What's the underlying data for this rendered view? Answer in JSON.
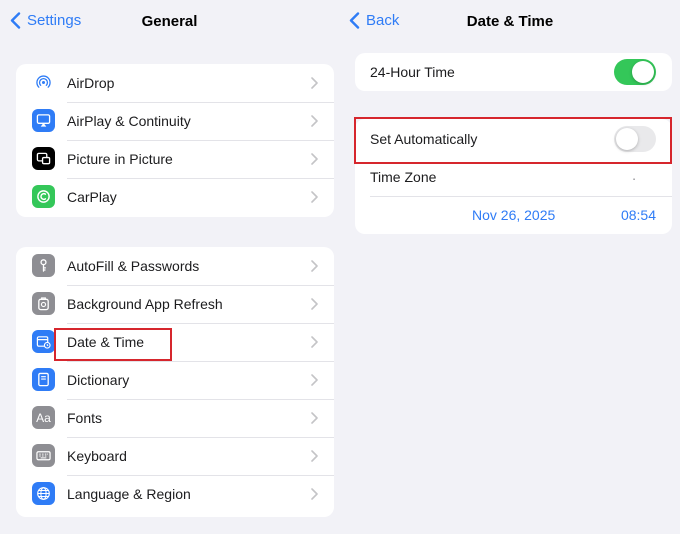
{
  "left": {
    "back_label": "Settings",
    "title": "General",
    "group1": [
      {
        "label": "AirDrop",
        "icon": "airdrop-icon"
      },
      {
        "label": "AirPlay & Continuity",
        "icon": "airplay-icon"
      },
      {
        "label": "Picture in Picture",
        "icon": "picture-in-picture-icon"
      },
      {
        "label": "CarPlay",
        "icon": "carplay-icon"
      }
    ],
    "group2": [
      {
        "label": "AutoFill & Passwords",
        "icon": "autofill-icon"
      },
      {
        "label": "Background App Refresh",
        "icon": "refresh-icon"
      },
      {
        "label": "Date & Time",
        "icon": "calendar-clock-icon"
      },
      {
        "label": "Dictionary",
        "icon": "dictionary-icon"
      },
      {
        "label": "Fonts",
        "icon": "fonts-icon",
        "glyph": "Aa"
      },
      {
        "label": "Keyboard",
        "icon": "keyboard-icon"
      },
      {
        "label": "Language & Region",
        "icon": "globe-icon"
      }
    ]
  },
  "right": {
    "back_label": "Back",
    "title": "Date & Time",
    "hour24_label": "24-Hour Time",
    "hour24_on": true,
    "set_auto_label": "Set Automatically",
    "set_auto_on": false,
    "timezone_label": "Time Zone",
    "timezone_value": ".",
    "date": "Nov 26, 2025",
    "time": "08:54"
  },
  "colors": {
    "accent": "#2f7cf6",
    "toggle_on": "#34c759",
    "highlight": "#d6262d"
  }
}
